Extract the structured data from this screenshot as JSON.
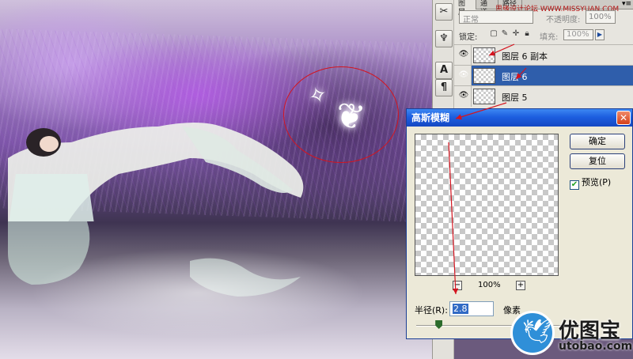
{
  "canvas": {
    "scene": "photo"
  },
  "tools": {
    "icons": [
      "wrench-icon",
      "brush-icon",
      "text-icon",
      "paragraph-icon"
    ],
    "text_label": "A",
    "paragraph_label": "¶"
  },
  "layers_panel": {
    "tabs": [
      {
        "label": "图层",
        "active": true
      },
      {
        "label": "通道",
        "active": false
      },
      {
        "label": "路径",
        "active": false
      }
    ],
    "watermark": "思缘设计论坛 WWW.MISSYUAN.COM",
    "blend_mode": "正常",
    "opacity_label": "不透明度:",
    "opacity_value": "100%",
    "lock_label": "锁定:",
    "fill_label": "填充:",
    "fill_value": "100%",
    "layers": [
      {
        "name": "图层 6 副本",
        "selected": false
      },
      {
        "name": "图层 6",
        "selected": true
      },
      {
        "name": "图层 5",
        "selected": false
      }
    ]
  },
  "dialog": {
    "title": "高斯模糊",
    "ok_label": "确定",
    "reset_label": "复位",
    "preview_label": "预览(P)",
    "preview_checked": true,
    "zoom_value": "100%",
    "radius_label": "半径(R):",
    "radius_value": "2.8",
    "radius_unit": "像素",
    "slider_fraction": 0.11
  },
  "logo": {
    "brand": "优图宝",
    "url": "utobao.com"
  },
  "colors": {
    "title_bar": "#1d5ee0",
    "selected_layer": "#2f5eab",
    "annotation_red": "#d4141f"
  }
}
